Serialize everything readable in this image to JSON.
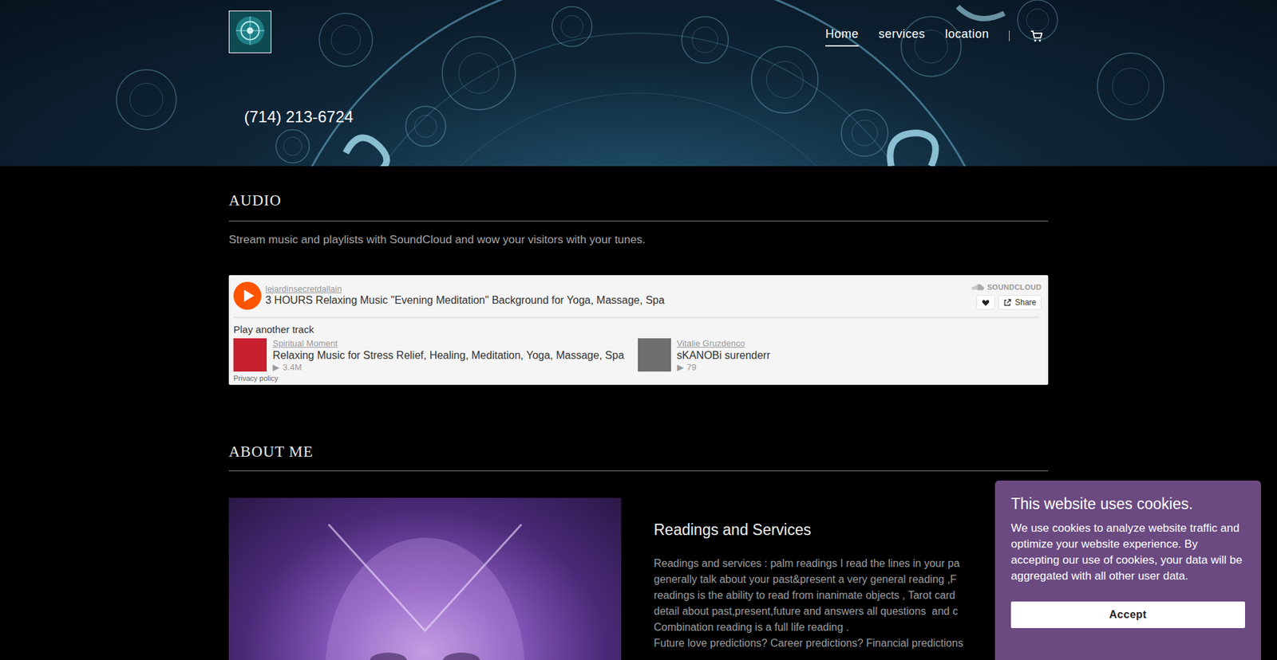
{
  "nav": {
    "items": [
      {
        "label": "Home",
        "selected": true
      },
      {
        "label": "services",
        "selected": false
      },
      {
        "label": "location",
        "selected": false
      }
    ]
  },
  "phone": "(714) 213-6724",
  "audio": {
    "title": "AUDIO",
    "description": "Stream music and playlists with SoundCloud and wow your visitors with your tunes.",
    "player": {
      "user": "lejardinsecretdallain",
      "track": "3 HOURS Relaxing Music \"Evening Meditation\" Background for Yoga, Massage, Spa",
      "brand": "SOUNDCLOUD",
      "share": "Share",
      "liked": false,
      "level": 0,
      "more_title": "Play another track",
      "tracks": [
        {
          "user": "Spiritual Moment",
          "title": "Relaxing Music for Stress Relief, Healing, Meditation, Yoga, Massage, Spa",
          "play_glyph": "▶",
          "plays": "3.4M",
          "color": "#c8202f"
        },
        {
          "user": "Vitalie Gruzdenco",
          "title": "sKANOBi surenderr",
          "play_glyph": "▶",
          "plays": "79",
          "color": "#6f6f6f"
        }
      ],
      "privacy": "Privacy policy"
    }
  },
  "about": {
    "title": "ABOUT ME",
    "heading": "Readings and Services",
    "lines": [
      "Readings and services : palm readings I read the lines in your pa",
      "generally talk about your past&present a very general reading ,F",
      "readings is the ability to read from inanimate objects , Tarot card",
      "detail about past,present,future and answers all questions  and c",
      "Combination reading is a full life reading .",
      "Future love predictions? Career predictions? Financial predictions"
    ]
  },
  "cookie_banner": {
    "title": "This website uses cookies.",
    "text": "We use cookies to analyze website traffic and optimize your website experience. By accepting our use of cookies, your data will be aggregated with all other user data.",
    "button": "Accept"
  }
}
